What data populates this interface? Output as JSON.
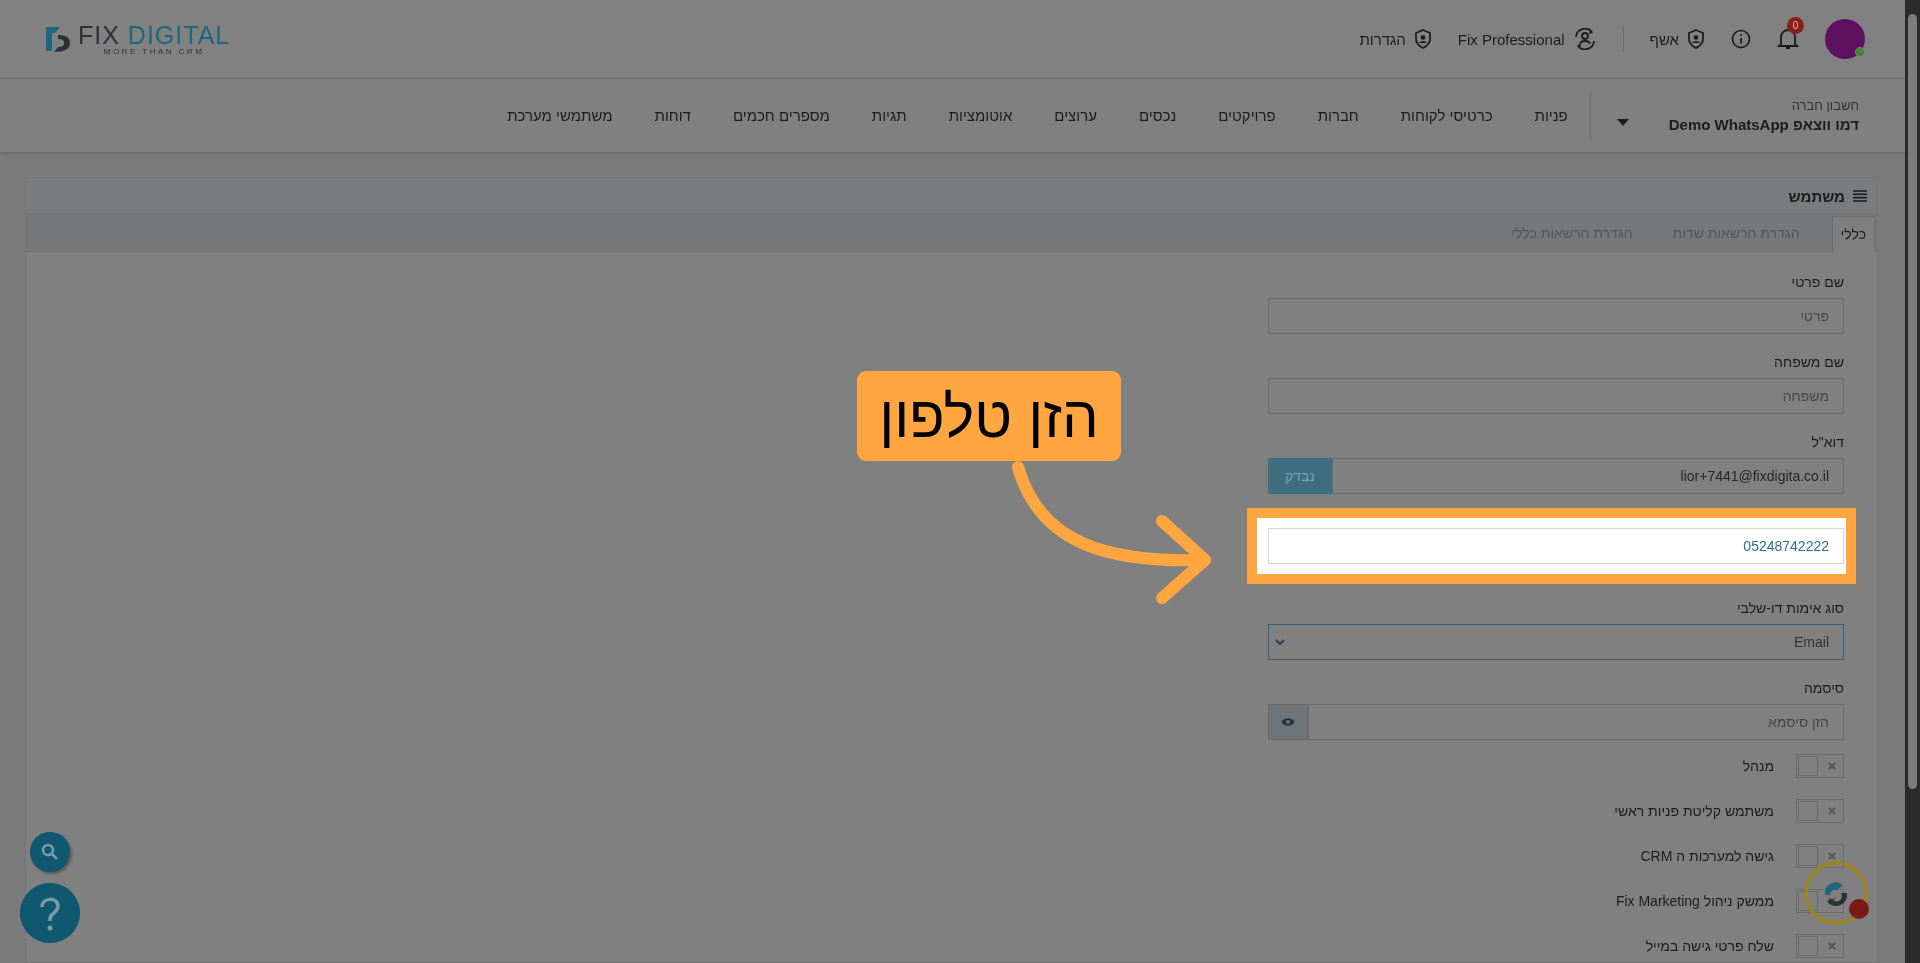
{
  "header": {
    "brand": "FIX DIGITAL",
    "tagline": "MORE THAN CRM",
    "avatar": {
      "online": true
    },
    "notifications": {
      "count": "0"
    },
    "links": [
      {
        "kind": "wizard",
        "label": "אשף"
      },
      {
        "kind": "professional",
        "label": "Fix Professional"
      },
      {
        "kind": "settings",
        "label": "הגדרות"
      }
    ]
  },
  "nav": {
    "account_label": "חשבון חברה",
    "account_name": "דמו ווצאפ Demo WhatsApp",
    "items": [
      "פניות",
      "כרטיסי לקוחות",
      "חברות",
      "פרויקטים",
      "נכסים",
      "ערוצים",
      "אוטומציות",
      "תגיות",
      "מספרים חכמים",
      "דוחות",
      "משתמשי מערכת"
    ]
  },
  "card": {
    "title": "משתמש",
    "tabs": [
      {
        "label": "כללי",
        "selected": true
      },
      {
        "label": "הגדרת הרשאות שדות",
        "selected": false
      },
      {
        "label": "הגדרת הרשאות כללי",
        "selected": false
      }
    ],
    "fields": [
      {
        "kind": "text",
        "label": "שם פרטי",
        "placeholder": "פרטי",
        "highlighted": false
      },
      {
        "kind": "text",
        "label": "שם משפחה",
        "placeholder": "משפחה",
        "highlighted": false
      },
      {
        "kind": "email",
        "label": "דוא\"ל",
        "value": "lior+7441@fixdigita.co.il",
        "button": "נבדק",
        "highlighted": false
      },
      {
        "kind": "text",
        "value": "05248742222",
        "highlighted": true
      },
      {
        "kind": "select",
        "label": "סוג אימות דו-שלבי",
        "value": "Email",
        "highlighted": false
      },
      {
        "kind": "password",
        "label": "סיסמה",
        "placeholder": "הזן סיסמא",
        "highlighted": false
      }
    ],
    "toggles": [
      {
        "label": "מנהל",
        "on": false
      },
      {
        "label": "משתמש קליטת פניות ראשי",
        "on": false
      },
      {
        "label": "גישה למערכות ה CRM",
        "on": false
      },
      {
        "label": "ממשק ניהול Fix Marketing",
        "on": false
      },
      {
        "label": "שלח פרטי גישה במייל",
        "on": false
      }
    ]
  },
  "callout": {
    "text": "הזן טלפון"
  }
}
